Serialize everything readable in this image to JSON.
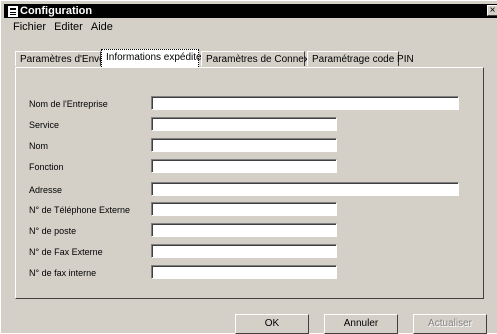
{
  "window": {
    "title": "Configuration",
    "close_glyph": "×"
  },
  "menu": [
    "Fichier",
    "Editer",
    "Aide"
  ],
  "tabs": [
    {
      "label": "Paramètres d'Envoi",
      "active": false
    },
    {
      "label": "Informations expéditeur",
      "active": true
    },
    {
      "label": "Paramètres de Connexion",
      "active": false
    },
    {
      "label": "Paramétrage code PIN",
      "active": false
    }
  ],
  "form": {
    "fields": [
      {
        "label": "Nom de l'Entreprise",
        "value": ""
      },
      {
        "label": "Service",
        "value": ""
      },
      {
        "label": "Nom",
        "value": ""
      },
      {
        "label": "Fonction",
        "value": ""
      },
      {
        "label": "Adresse",
        "value": ""
      },
      {
        "label": "N° de Téléphone Externe",
        "value": ""
      },
      {
        "label": "N° de poste",
        "value": ""
      },
      {
        "label": "N° de Fax Externe",
        "value": ""
      },
      {
        "label": "N° de fax interne",
        "value": ""
      }
    ]
  },
  "buttons": {
    "ok": "OK",
    "cancel": "Annuler",
    "update": "Actualiser"
  }
}
